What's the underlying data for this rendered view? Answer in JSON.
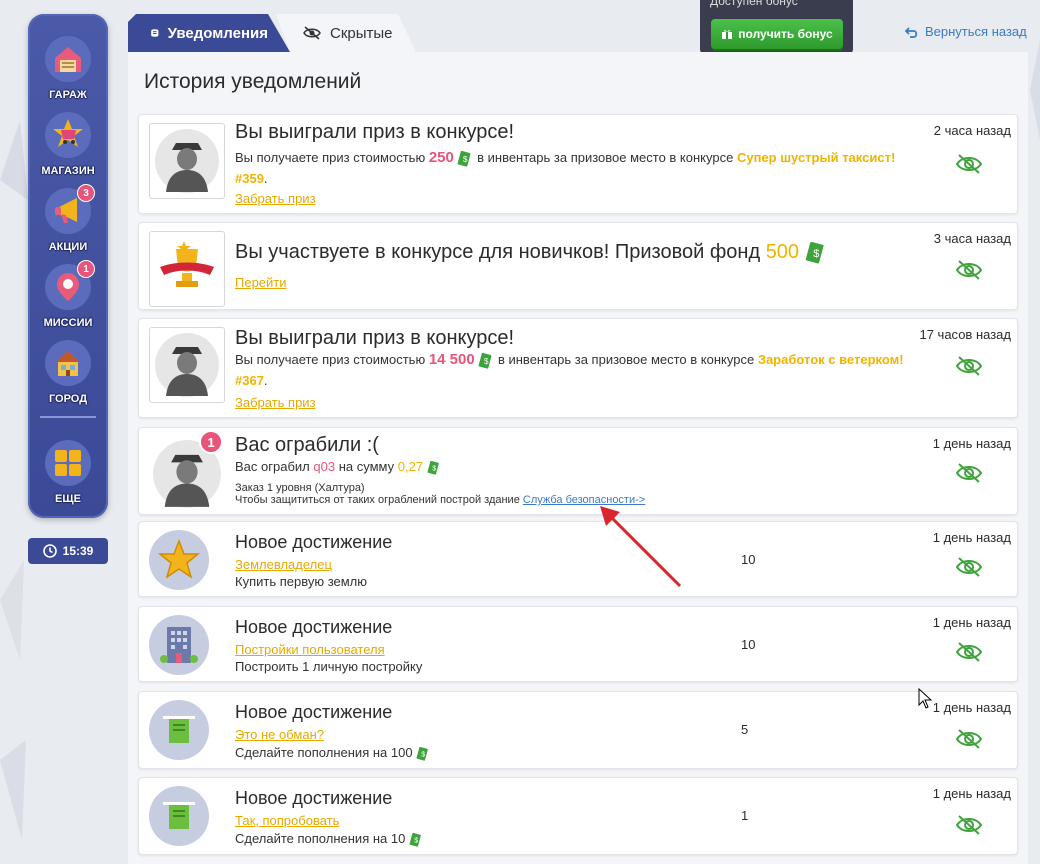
{
  "sidebar": {
    "items": [
      {
        "label": "ГАРАЖ",
        "icon": "garage-icon"
      },
      {
        "label": "МАГАЗИН",
        "icon": "shop-icon"
      },
      {
        "label": "АКЦИИ",
        "icon": "megaphone-icon",
        "badge": "3"
      },
      {
        "label": "МИССИИ",
        "icon": "mission-icon",
        "badge": "1"
      },
      {
        "label": "ГОРОД",
        "icon": "city-icon"
      },
      {
        "label": "ЕЩЕ",
        "icon": "more-icon"
      }
    ]
  },
  "clock": "15:39",
  "tabs": [
    {
      "label": "Уведомления",
      "active": true
    },
    {
      "label": "Скрытые",
      "active": false
    }
  ],
  "bonus": {
    "header": "Доступен бонус",
    "button": "получить бонус"
  },
  "back_link": "Вернуться назад",
  "page_title": "История уведомлений",
  "notifications": [
    {
      "title": "Вы выиграли приз в конкурсе!",
      "text_prefix": "Вы получаете приз стоимостью",
      "amount": "250",
      "text_mid": "в инвентарь за призовое место в конкурсе",
      "contest": "Супер шустрый таксист!",
      "contest_no": "#359",
      "link": "Забрать приз",
      "time": "2 часа назад"
    },
    {
      "title": "Вы участвуете в конкурсе для новичков! Призовой фонд",
      "amount": "500",
      "link": "Перейти",
      "time": "3 часа назад"
    },
    {
      "title": "Вы выиграли приз в конкурсе!",
      "text_prefix": "Вы получаете приз стоимостью",
      "amount": "14 500",
      "text_mid": "в инвентарь за призовое место в конкурсе",
      "contest": "Заработок с ветерком!",
      "contest_no": "#367",
      "link": "Забрать приз",
      "time": "17 часов назад"
    },
    {
      "title": "Вас ограбили :(",
      "badge": "1",
      "line1_prefix": "Вас ограбил",
      "robber": "q03",
      "line1_mid": "на сумму",
      "amount": "0,27",
      "line2": "Заказ 1 уровня (Халтура)",
      "line3": "Чтобы защититься от таких ограблений построй здание",
      "line3_link": "Служба безопасности->",
      "time": "1 день назад"
    }
  ],
  "achievements": [
    {
      "title": "Новое достижение",
      "link": "Землевладелец",
      "desc": "Купить первую землю",
      "count": "10",
      "time": "1 день назад",
      "icon": "star-icon"
    },
    {
      "title": "Новое достижение",
      "link": "Постройки пользователя",
      "desc": "Построить 1 личную постройку",
      "count": "10",
      "time": "1 день назад",
      "icon": "building-icon"
    },
    {
      "title": "Новое достижение",
      "link": "Это не обман?",
      "desc": "Сделайте пополнения на 100",
      "count": "5",
      "time": "1 день назад",
      "icon": "atm-icon"
    },
    {
      "title": "Новое достижение",
      "link": "Так, попробовать",
      "desc": "Сделайте пополнения на 10",
      "count": "1",
      "time": "1 день назад",
      "icon": "atm-icon"
    }
  ]
}
